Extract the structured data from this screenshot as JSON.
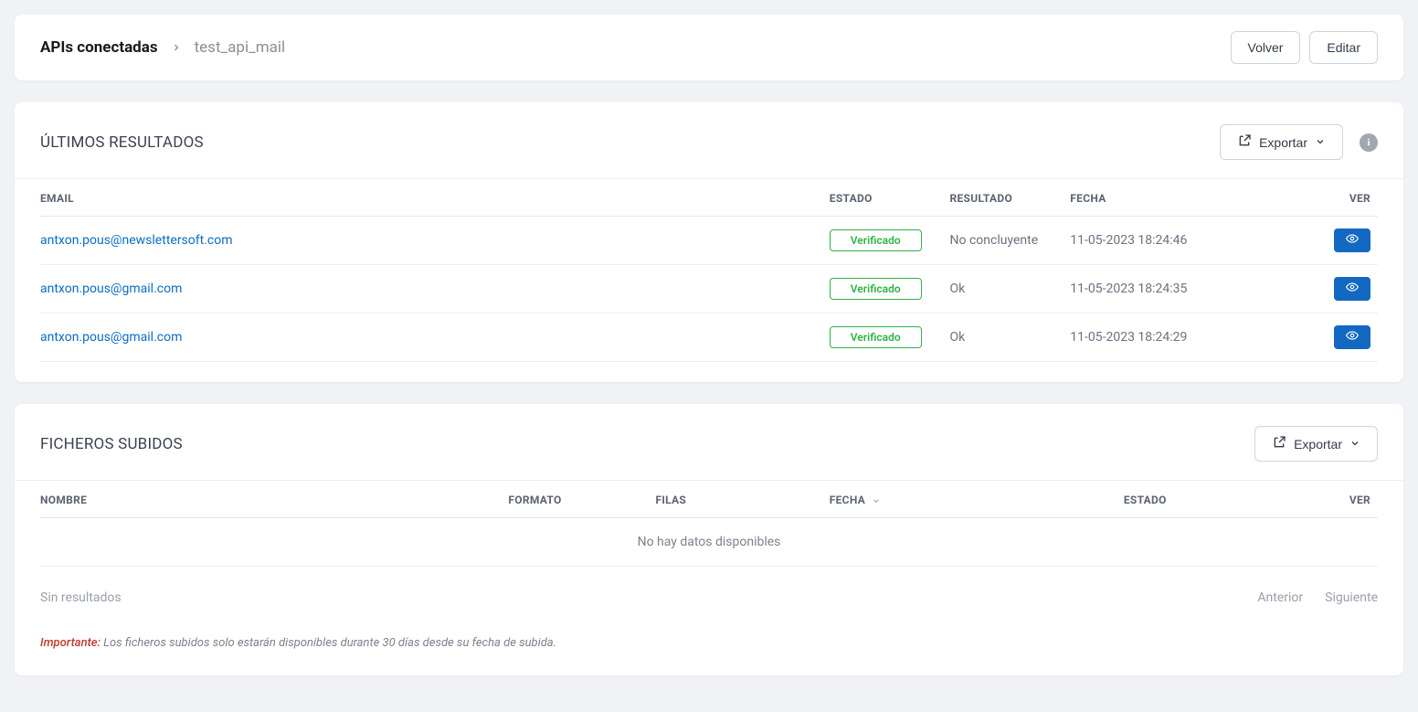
{
  "breadcrumb": {
    "root": "APIs conectadas",
    "current": "test_api_mail"
  },
  "header_buttons": {
    "back": "Volver",
    "edit": "Editar"
  },
  "results_section": {
    "title": "ÚLTIMOS RESULTADOS",
    "export_label": "Exportar",
    "columns": {
      "email": "EMAIL",
      "estado": "ESTADO",
      "resultado": "RESULTADO",
      "fecha": "FECHA",
      "ver": "VER"
    },
    "rows": [
      {
        "email": "antxon.pous@newslettersoft.com",
        "estado": "Verificado",
        "resultado": "No concluyente",
        "fecha": "11-05-2023 18:24:46"
      },
      {
        "email": "antxon.pous@gmail.com",
        "estado": "Verificado",
        "resultado": "Ok",
        "fecha": "11-05-2023 18:24:35"
      },
      {
        "email": "antxon.pous@gmail.com",
        "estado": "Verificado",
        "resultado": "Ok",
        "fecha": "11-05-2023 18:24:29"
      }
    ]
  },
  "files_section": {
    "title": "FICHEROS SUBIDOS",
    "export_label": "Exportar",
    "columns": {
      "nombre": "NOMBRE",
      "formato": "FORMATO",
      "filas": "FILAS",
      "fecha": "FECHA",
      "estado": "ESTADO",
      "ver": "VER"
    },
    "empty": "No hay datos disponibles",
    "footer_left": "Sin resultados",
    "pager": {
      "prev": "Anterior",
      "next": "Siguiente"
    },
    "note_strong": "Importante:",
    "note_text": "Los ficheros subidos solo estarán disponibles durante 30 días desde su fecha de subida."
  }
}
